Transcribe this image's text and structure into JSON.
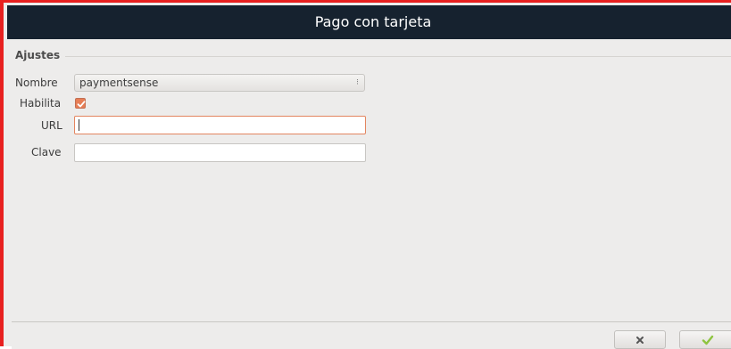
{
  "window": {
    "title": "Pago con tarjeta"
  },
  "settings": {
    "group_title": "Ajustes",
    "name_label": "Nombre",
    "name_value": "paymentsense",
    "enable_label": "Habilita",
    "enable_checked": true,
    "url_label": "URL",
    "url_value": "",
    "key_label": "Clave",
    "key_value": ""
  },
  "footer": {
    "cancel_icon": "close-icon",
    "ok_icon": "checkmark-icon"
  },
  "colors": {
    "titlebar_bg": "#16222f",
    "accent": "#e77e56",
    "ok_green": "#8ec43f"
  }
}
